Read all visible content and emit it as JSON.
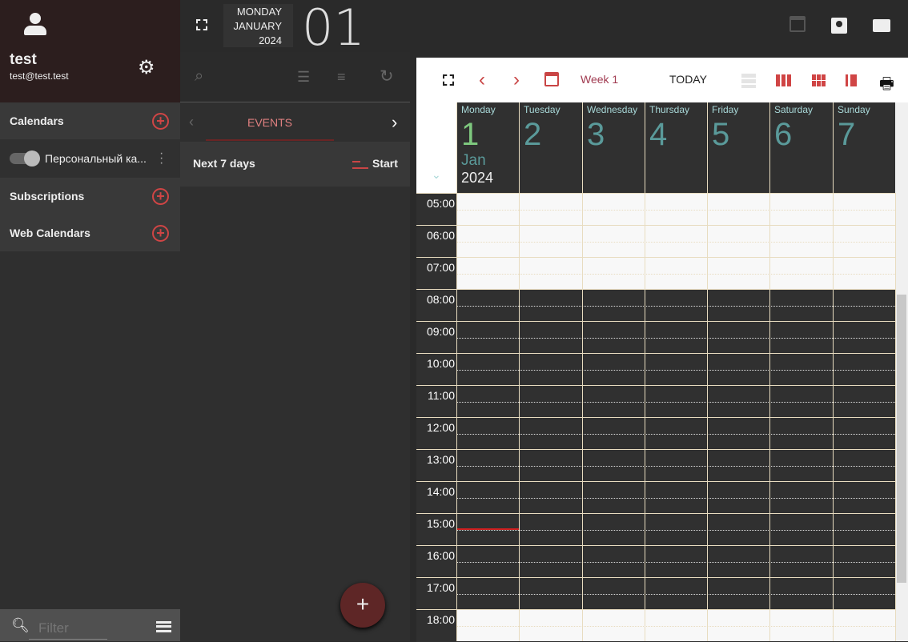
{
  "user": {
    "name": "test",
    "email": "test@test.test"
  },
  "sidebar": {
    "sections": [
      {
        "label": "Calendars"
      },
      {
        "label": "Subscriptions"
      },
      {
        "label": "Web Calendars"
      }
    ],
    "calendar_item": "Персональный ка...",
    "filter_placeholder": "Filter"
  },
  "header": {
    "weekday": "MONDAY",
    "month": "JANUARY",
    "year": "2024",
    "day": "01"
  },
  "events_panel": {
    "tab": "EVENTS",
    "range": "Next 7 days",
    "sort_label": "Start",
    "add_label": "+"
  },
  "toolbar": {
    "week": "Week 1",
    "today": "TODAY"
  },
  "week": {
    "days": [
      {
        "name": "Monday",
        "num": "1"
      },
      {
        "name": "Tuesday",
        "num": "2"
      },
      {
        "name": "Wednesday",
        "num": "3"
      },
      {
        "name": "Thursday",
        "num": "4"
      },
      {
        "name": "Friday",
        "num": "5"
      },
      {
        "name": "Saturday",
        "num": "6"
      },
      {
        "name": "Sunday",
        "num": "7"
      }
    ],
    "month": "Jan",
    "year": "2024"
  },
  "hours": [
    "05:00",
    "06:00",
    "07:00",
    "08:00",
    "09:00",
    "10:00",
    "11:00",
    "12:00",
    "13:00",
    "14:00",
    "15:00",
    "16:00",
    "17:00",
    "18:00"
  ],
  "colors": {
    "accent": "#d04545",
    "today_green": "#7ec87e",
    "work_hours_bg": "#303030"
  }
}
